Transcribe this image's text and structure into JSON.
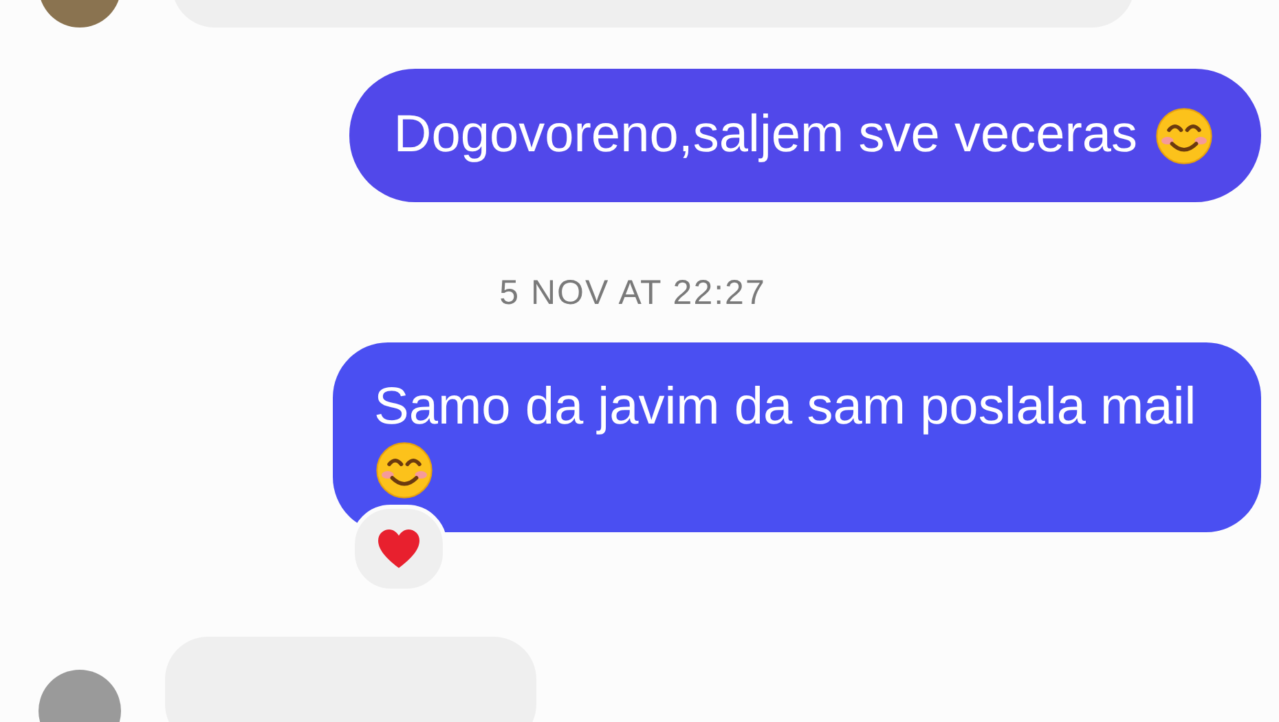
{
  "messages": [
    {
      "kind": "incoming",
      "avatar": true
    },
    {
      "kind": "outgoing",
      "text": "Dogovoreno,saljem sve veceras",
      "emoji": true,
      "reacted": false
    },
    {
      "kind": "timestamp",
      "text": "5 NOV AT 22:27"
    },
    {
      "kind": "outgoing",
      "text": "Samo da javim da sam poslala mail",
      "emoji": true,
      "reacted": true
    },
    {
      "kind": "incoming",
      "avatar": true
    }
  ]
}
